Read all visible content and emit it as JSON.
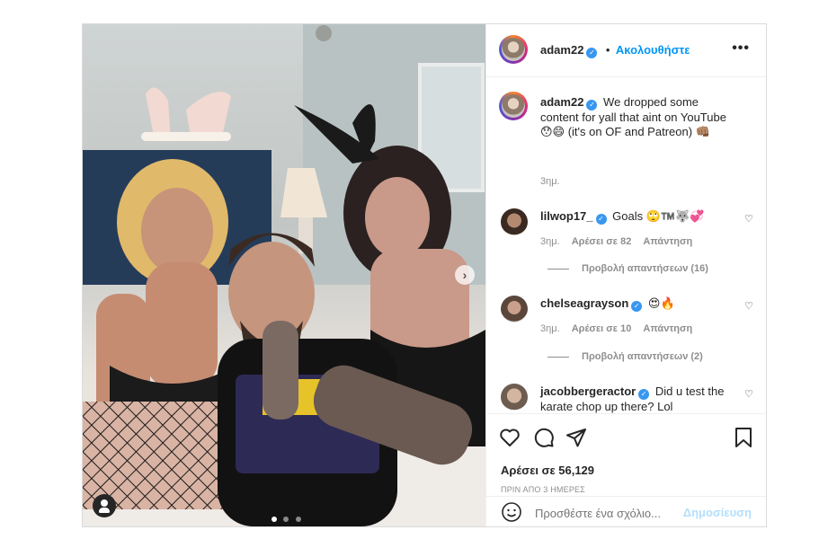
{
  "post": {
    "author": "adam22",
    "follow_label": "Ακολουθήστε",
    "more_icon": "more-horizontal-icon",
    "caption": {
      "username": "adam22",
      "text": "We dropped some content for yall that aint on YouTube 😯😄 (it's on OF and Patreon) 👊🏽",
      "time": "3ημ."
    },
    "comments": [
      {
        "username": "lilwop17_",
        "text": "Goals 🙄™️🐺💞",
        "time": "3ημ.",
        "likes": "Αρέσει σε 82",
        "reply_label": "Απάντηση",
        "view_replies": "Προβολή απαντήσεων (16)"
      },
      {
        "username": "chelseagrayson",
        "text": "😍🔥",
        "time": "3ημ.",
        "likes": "Αρέσει σε 10",
        "reply_label": "Απάντηση",
        "view_replies": "Προβολή απαντήσεων (2)"
      },
      {
        "username": "jacobbergeractor",
        "text": "Did u test the karate chop up there? Lol"
      }
    ],
    "likes": "Αρέσει σε 56,129",
    "date": "ΠΡΙΝ ΑΠΟ 3 ΗΜΕΡΕΣ",
    "add_comment_placeholder": "Προσθέστε ένα σχόλιο...",
    "post_button": "Δημοσίευση",
    "carousel": {
      "current": 1,
      "total": 3
    }
  },
  "colors": {
    "accent": "#0095f6",
    "post_button_disabled": "#b2dffc",
    "verified": "#3897f0",
    "text": "#262626",
    "secondary": "#8e8e8e"
  }
}
